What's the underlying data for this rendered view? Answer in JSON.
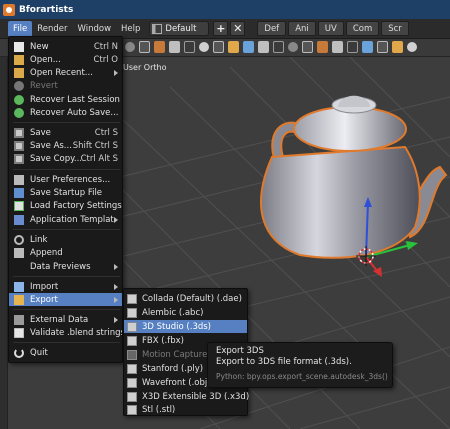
{
  "titlebar": {
    "title": "Bforartists"
  },
  "menubar": {
    "items": [
      "File",
      "Render",
      "Window",
      "Help"
    ],
    "layout": "Default",
    "workspace_tabs": [
      "Def",
      "Ani",
      "UV",
      "Com",
      "Scr"
    ]
  },
  "viewport": {
    "view_label": "User Ortho"
  },
  "file_menu": {
    "items": [
      {
        "label": "New",
        "shortcut": "Ctrl N",
        "icon": "new-file-icon"
      },
      {
        "label": "Open...",
        "shortcut": "Ctrl O",
        "icon": "open-folder-icon"
      },
      {
        "label": "Open Recent...",
        "shortcut": "",
        "icon": "open-recent-icon",
        "submenu": true
      },
      {
        "label": "Revert",
        "shortcut": "",
        "icon": "revert-icon",
        "disabled": true
      },
      {
        "label": "Recover Last Session",
        "shortcut": "",
        "icon": "recover-session-icon"
      },
      {
        "label": "Recover Auto Save...",
        "shortcut": "",
        "icon": "recover-autosave-icon"
      },
      {
        "label": "Save",
        "shortcut": "Ctrl S",
        "icon": "save-icon"
      },
      {
        "label": "Save As...",
        "shortcut": "Shift Ctrl S",
        "icon": "save-as-icon"
      },
      {
        "label": "Save Copy...",
        "shortcut": "Ctrl Alt S",
        "icon": "save-copy-icon"
      },
      {
        "label": "User Preferences...",
        "shortcut": "",
        "icon": "preferences-icon"
      },
      {
        "label": "Save Startup File",
        "shortcut": "",
        "icon": "startup-file-icon"
      },
      {
        "label": "Load Factory Settings",
        "shortcut": "",
        "icon": "factory-settings-icon"
      },
      {
        "label": "Application Templates",
        "shortcut": "",
        "icon": "templates-icon",
        "submenu": true
      },
      {
        "label": "Link",
        "shortcut": "",
        "icon": "link-icon"
      },
      {
        "label": "Append",
        "shortcut": "",
        "icon": "append-icon"
      },
      {
        "label": "Data Previews",
        "shortcut": "",
        "icon": "",
        "submenu": true
      },
      {
        "label": "Import",
        "shortcut": "",
        "icon": "import-icon",
        "submenu": true
      },
      {
        "label": "Export",
        "shortcut": "",
        "icon": "export-icon",
        "submenu": true,
        "active": true
      },
      {
        "label": "External Data",
        "shortcut": "",
        "icon": "external-data-icon",
        "submenu": true
      },
      {
        "label": "Validate .blend strings",
        "shortcut": "",
        "icon": "validate-icon"
      },
      {
        "label": "Quit",
        "shortcut": "",
        "icon": "quit-icon"
      }
    ]
  },
  "export_menu": {
    "items": [
      {
        "label": "Collada (Default) (.dae)"
      },
      {
        "label": "Alembic (.abc)"
      },
      {
        "label": "3D Studio (.3ds)",
        "active": true
      },
      {
        "label": "FBX (.fbx)"
      },
      {
        "label": "Motion Capture (.bvh)",
        "disabled": true
      },
      {
        "label": "Stanford (.ply)"
      },
      {
        "label": "Wavefront (.obj)"
      },
      {
        "label": "X3D Extensible 3D (.x3d)"
      },
      {
        "label": "Stl (.stl)"
      }
    ]
  },
  "tooltip": {
    "title": "Export 3DS",
    "description": "Export to 3DS file format (.3ds).",
    "python": "Python: bpy.ops.export_scene.autodesk_3ds()"
  },
  "colors": {
    "accent": "#5680c2",
    "titlebar": "#1e3f66",
    "menu_bg": "#1a1a1a",
    "selection_outline": "#e07a2c"
  }
}
